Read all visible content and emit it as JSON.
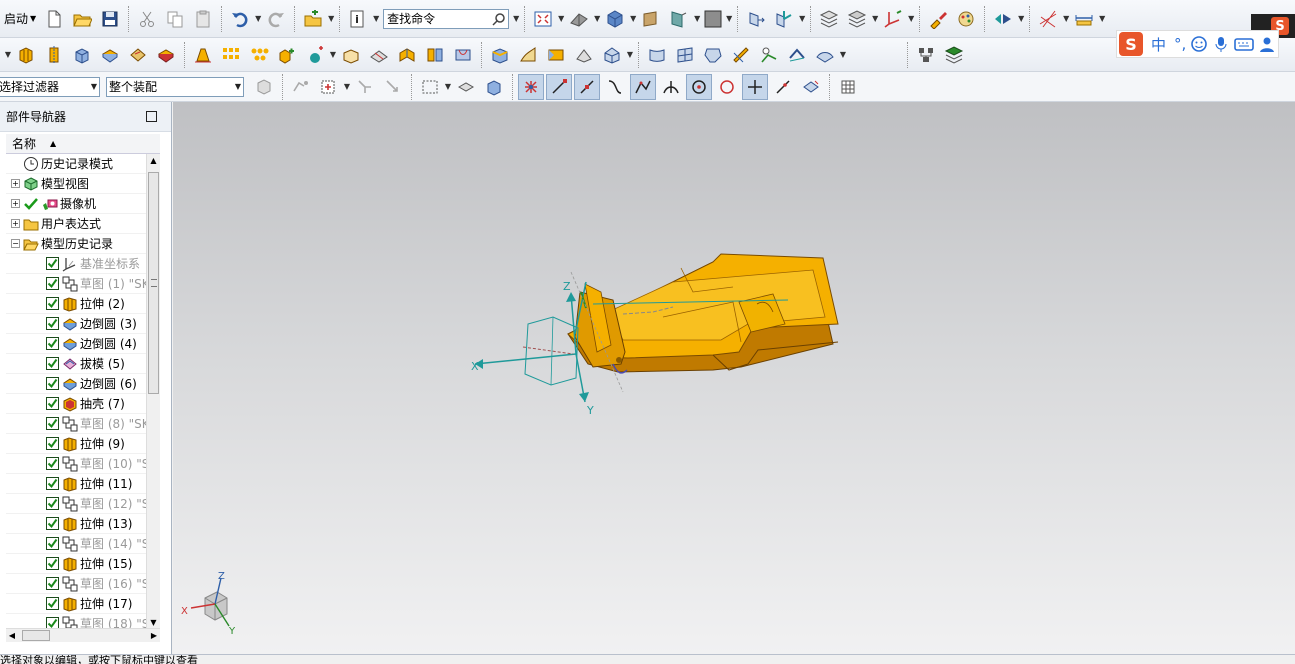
{
  "toolbar": {
    "start_label": "启动",
    "search_command": "查找命令"
  },
  "filter_bar": {
    "selection_filter": "选择过滤器",
    "assembly_scope": "整个装配"
  },
  "ime": {
    "logo": "S",
    "mode": "中",
    "punct": "°,"
  },
  "navigator": {
    "title": "部件导航器",
    "column_name": "名称",
    "items": [
      {
        "label": "历史记录模式",
        "level": 1,
        "expander": "",
        "icon": "clock-icon",
        "checked": false,
        "dim": false
      },
      {
        "label": "模型视图",
        "level": 1,
        "expander": "+",
        "icon": "model-views-icon",
        "checked": false,
        "dim": false
      },
      {
        "label": "摄像机",
        "level": 1,
        "expander": "+",
        "icon": "camera-icon",
        "checked": true,
        "dim": false
      },
      {
        "label": "用户表达式",
        "level": 1,
        "expander": "+",
        "icon": "folder-icon",
        "checked": false,
        "dim": false
      },
      {
        "label": "模型历史记录",
        "level": 1,
        "expander": "−",
        "icon": "folder-open-icon",
        "checked": false,
        "dim": false
      },
      {
        "label": "基准坐标系",
        "level": 2,
        "icon": "datum-csys-icon",
        "dim": true
      },
      {
        "label": "草图 (1) \"SK",
        "level": 2,
        "icon": "sketch-icon",
        "dim": true
      },
      {
        "label": "拉伸 (2)",
        "level": 2,
        "icon": "extrude-icon",
        "dim": false
      },
      {
        "label": "边倒圆 (3)",
        "level": 2,
        "icon": "edge-blend-icon",
        "dim": false
      },
      {
        "label": "边倒圆 (4)",
        "level": 2,
        "icon": "edge-blend-icon",
        "dim": false
      },
      {
        "label": "拔模 (5)",
        "level": 2,
        "icon": "draft-icon",
        "dim": false
      },
      {
        "label": "边倒圆 (6)",
        "level": 2,
        "icon": "edge-blend-icon",
        "dim": false
      },
      {
        "label": "抽壳 (7)",
        "level": 2,
        "icon": "shell-icon",
        "dim": false
      },
      {
        "label": "草图 (8) \"SK",
        "level": 2,
        "icon": "sketch-icon",
        "dim": true
      },
      {
        "label": "拉伸 (9)",
        "level": 2,
        "icon": "extrude-icon",
        "dim": false
      },
      {
        "label": "草图 (10) \"S",
        "level": 2,
        "icon": "sketch-icon",
        "dim": true
      },
      {
        "label": "拉伸 (11)",
        "level": 2,
        "icon": "extrude-icon",
        "dim": false
      },
      {
        "label": "草图 (12) \"S",
        "level": 2,
        "icon": "sketch-icon",
        "dim": true
      },
      {
        "label": "拉伸 (13)",
        "level": 2,
        "icon": "extrude-icon",
        "dim": false
      },
      {
        "label": "草图 (14) \"S",
        "level": 2,
        "icon": "sketch-icon",
        "dim": true
      },
      {
        "label": "拉伸 (15)",
        "level": 2,
        "icon": "extrude-icon",
        "dim": false
      },
      {
        "label": "草图 (16) \"S",
        "level": 2,
        "icon": "sketch-icon",
        "dim": true
      },
      {
        "label": "拉伸 (17)",
        "level": 2,
        "icon": "extrude-icon",
        "dim": false
      },
      {
        "label": "草图 (18) \"S",
        "level": 2,
        "icon": "sketch-icon",
        "dim": true
      }
    ]
  },
  "viewport": {
    "axis_labels": {
      "x": "X",
      "y": "Y",
      "z": "Z"
    },
    "triad_labels": {
      "x": "X",
      "y": "Y",
      "z": "Z"
    }
  },
  "colors": {
    "part_fill": "#f5b000",
    "part_edge": "#7a4b00",
    "csys": "#1f9a9a",
    "selection": "#c5d6ea"
  },
  "status": {
    "message": "选择对象以编辑，或按下鼠标中键以查看"
  }
}
